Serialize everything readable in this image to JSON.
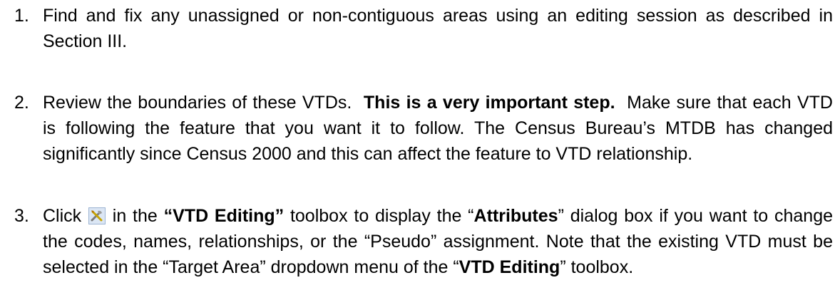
{
  "items": [
    {
      "number": "1.",
      "text": "Find and fix any unassigned or non-contiguous areas using an editing session as described in Section III."
    },
    {
      "number": "2.",
      "text_a": "Review the boundaries of these VTDs.",
      "bold": "This is a very important step.",
      "text_b": "Make sure that each VTD is following the feature that you want it to follow.  The Census Bureau’s MTDB has changed significantly since Census 2000 and this can affect the feature to VTD relationship."
    },
    {
      "number": "3.",
      "before_icon": "Click",
      "icon": "attributes-tool-icon",
      "after_icon": "in the",
      "bold_1": "“VTD Editing”",
      "seg_2": "toolbox to display the “",
      "bold_2": "Attributes",
      "seg_3": "” dialog box if you want to change the codes, names, relationships, or the “Pseudo” assignment.  Note that the existing VTD must be selected in the “Target Area” dropdown menu of the “",
      "bold_3": "VTD Editing",
      "seg_4": "” toolbox."
    }
  ]
}
